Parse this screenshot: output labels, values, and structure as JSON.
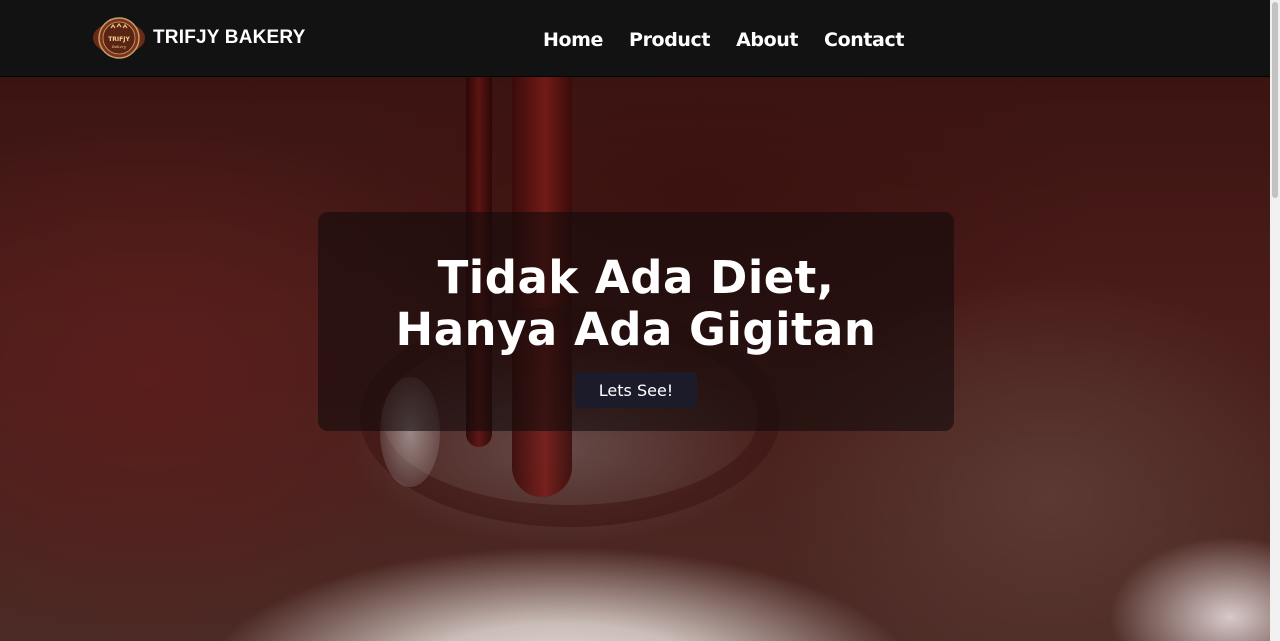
{
  "brand": {
    "name": "TRIFJY BAKERY",
    "logo_text": "TRIFJY",
    "logo_subtext": "Bakery",
    "logo_icon": "bakery-badge-logo"
  },
  "nav": {
    "items": [
      {
        "label": "Home"
      },
      {
        "label": "Product"
      },
      {
        "label": "About"
      },
      {
        "label": "Contact"
      }
    ]
  },
  "hero": {
    "title_line1": "Tidak Ada Diet,",
    "title_line2": "Hanya Ada Gigitan",
    "button_label": "Lets See!",
    "background": "melted-chocolate-swirl-image"
  },
  "colors": {
    "navbar_bg": "#121212",
    "card_bg": "rgba(20,12,12,0.62)",
    "button_bg": "#1b1b2a",
    "text": "#ffffff"
  }
}
